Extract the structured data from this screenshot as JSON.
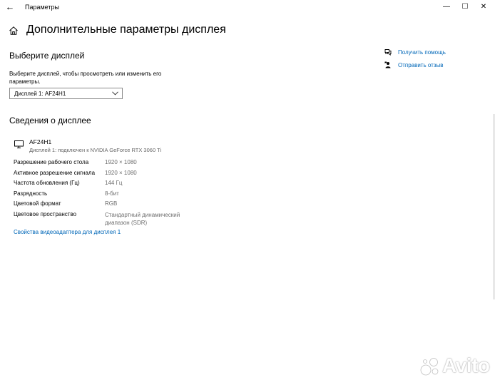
{
  "window": {
    "title": "Параметры",
    "back_glyph": "←",
    "minimize_glyph": "—",
    "maximize_glyph": "☐",
    "close_glyph": "✕"
  },
  "page": {
    "title": "Дополнительные параметры дисплея"
  },
  "select_section": {
    "heading": "Выберите дисплей",
    "description": "Выберите дисплей, чтобы просмотреть или изменить его параметры.",
    "dropdown_value": "Дисплей 1: AF24H1"
  },
  "info_section": {
    "heading": "Сведения о дисплее",
    "monitor_name": "AF24H1",
    "monitor_subtitle": "Дисплей 1: подключен к NVIDIA GeForce RTX 3060 Ti",
    "rows": [
      {
        "label": "Разрешение рабочего стола",
        "value": "1920 × 1080"
      },
      {
        "label": "Активное разрешение сигнала",
        "value": "1920 × 1080"
      },
      {
        "label": "Частота обновления (Гц)",
        "value": "144 Гц"
      },
      {
        "label": "Разрядность",
        "value": "8-бит"
      },
      {
        "label": "Цветовой формат",
        "value": "RGB"
      },
      {
        "label": "Цветовое пространство",
        "value": "Стандартный динамический диапазон (SDR)"
      }
    ],
    "adapter_link": "Свойства видеоадаптера для дисплея 1"
  },
  "side_links": {
    "help": "Получить помощь",
    "feedback": "Отправить отзыв"
  },
  "watermark": {
    "text": "Avito"
  },
  "colors": {
    "link": "#0067b8",
    "secondary_text": "#6e6e6e",
    "border": "#8a8a8a"
  }
}
